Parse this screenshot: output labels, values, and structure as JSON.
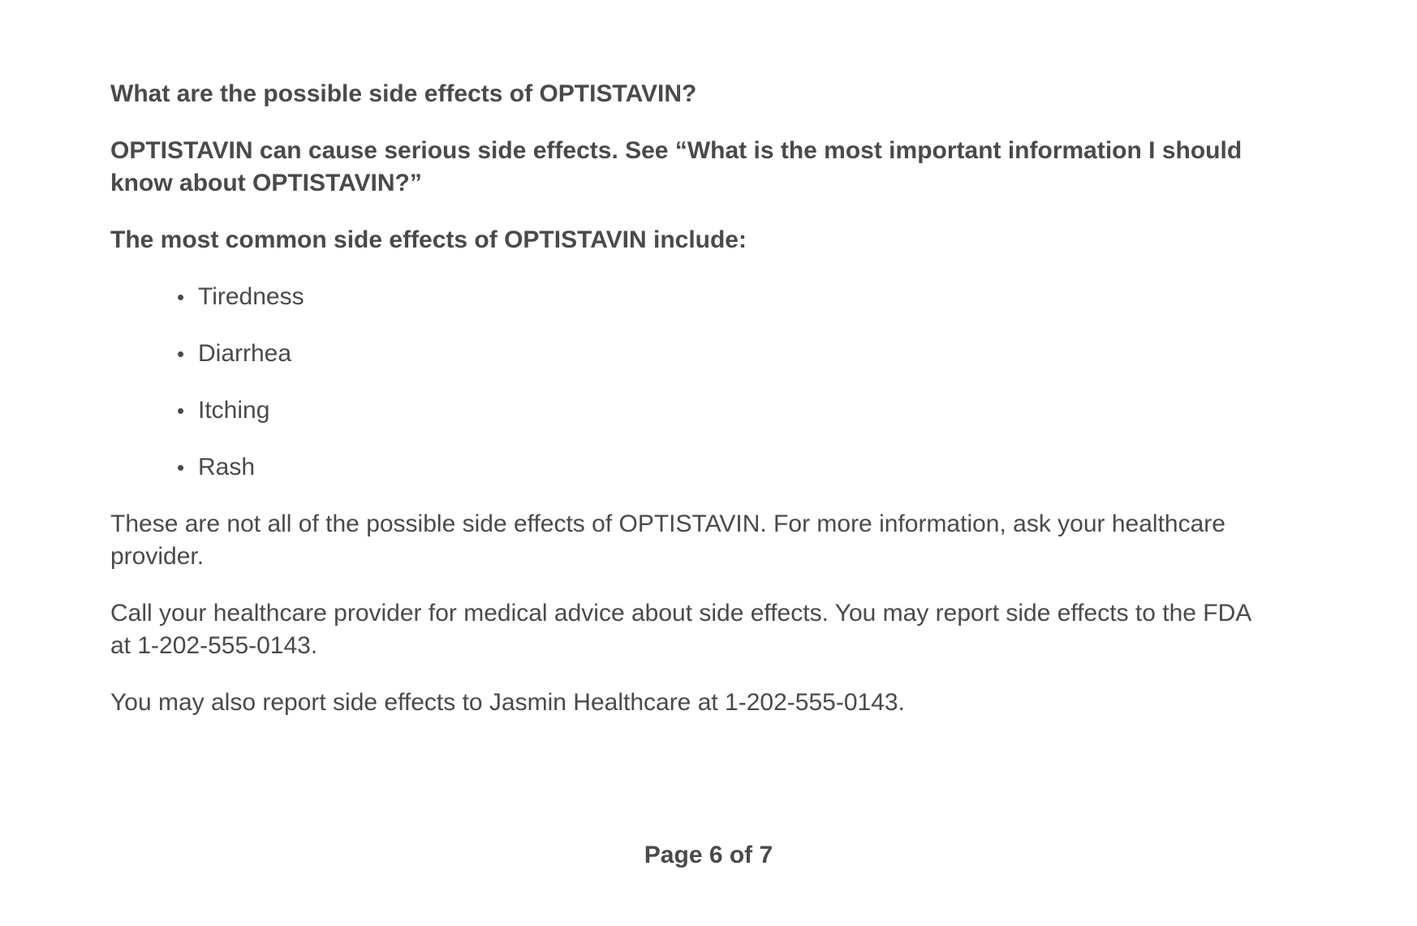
{
  "heading": "What are the possible side effects of OPTISTAVIN?",
  "warning": "OPTISTAVIN can cause serious side effects. See “What is the most important information I should know about OPTISTAVIN?”",
  "common_intro": "The most common side effects of OPTISTAVIN include:",
  "bullet_glyph": "•",
  "side_effects": [
    "Tiredness",
    "Diarrhea",
    "Itching",
    "Rash"
  ],
  "not_all": "These are not all of the possible side effects of OPTISTAVIN. For more information, ask your healthcare provider.",
  "call_provider": "Call your healthcare provider for medical advice about side effects. You may report side effects to the FDA at 1-202-555-0143.",
  "report_company": "You may also report side effects to Jasmin Healthcare at 1-202-555-0143.",
  "footer": "Page 6 of 7"
}
